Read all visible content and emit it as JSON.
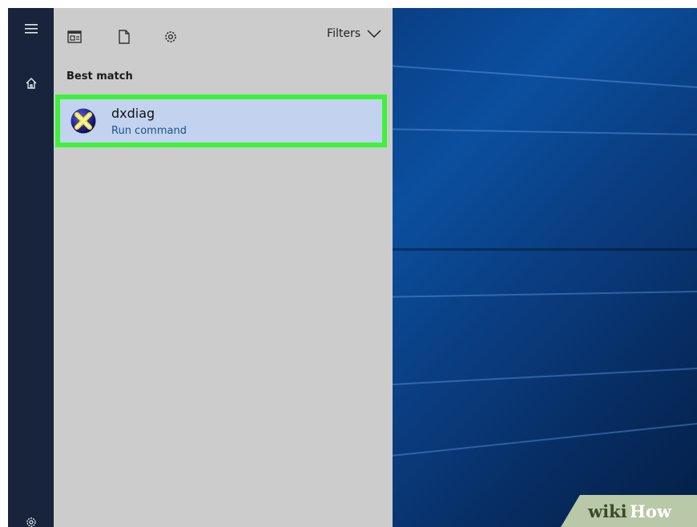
{
  "toolbar": {
    "filters_label": "Filters"
  },
  "results": {
    "section_label": "Best match",
    "best_match": {
      "title": "dxdiag",
      "subtitle": "Run command"
    }
  },
  "watermark": {
    "text": "wikiHow"
  },
  "colors": {
    "highlight_border": "#3ef23a",
    "result_bg": "#c3d3ef",
    "panel_bg": "#cccccc",
    "subtitle_text": "#1f4f8f"
  },
  "icons": {
    "menu": "hamburger-icon",
    "home": "home-icon",
    "apps": "apps-icon",
    "documents": "document-icon",
    "settings": "gear-icon",
    "filters": "chevron-down-icon",
    "result": "dxdiag-icon"
  }
}
